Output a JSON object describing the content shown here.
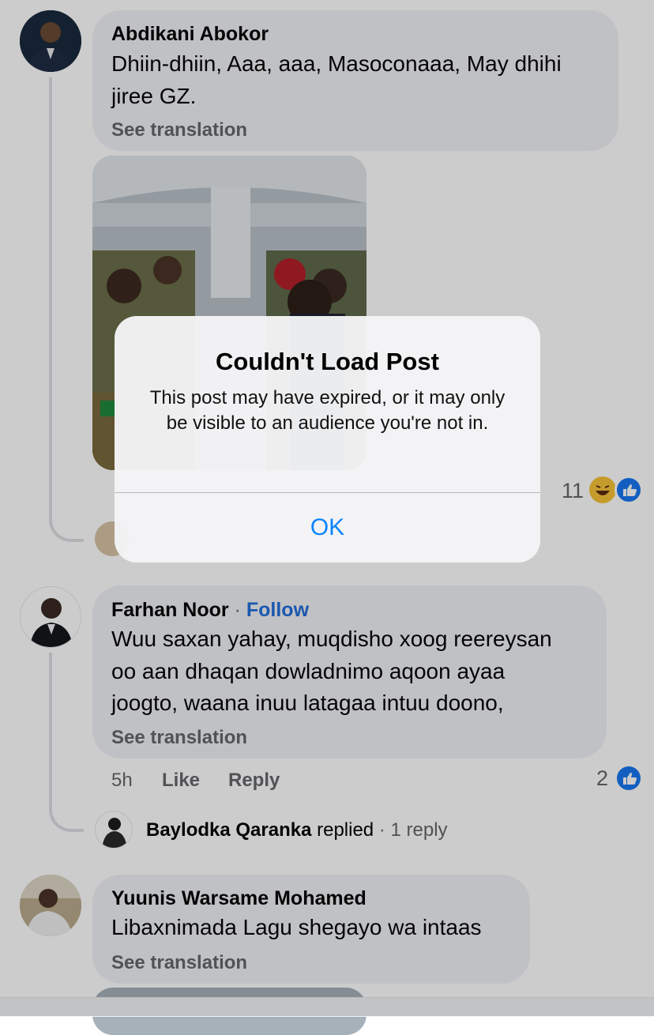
{
  "comments": [
    {
      "author": "Abdikani Abokor",
      "text_line1": "Dhiin-dhiin, Aaa, aaa, Masoconaaa, May dhihi",
      "text_line2": "jiree GZ.",
      "see_translation": "See translation",
      "reaction_count": "11"
    },
    {
      "author": "Farhan Noor",
      "follow_separator": "·",
      "follow_label": "Follow",
      "text_line1": "Wuu saxan yahay, muqdisho xoog reereysan",
      "text_line2": "oo aan dhaqan dowladnimo aqoon ayaa",
      "text_line3": "joogto, waana inuu latagaa intuu doono,",
      "see_translation": "See translation",
      "time": "5h",
      "like_label": "Like",
      "reply_label": "Reply",
      "reaction_count": "2",
      "reply_summary": {
        "replier": "Baylodka Qaranka",
        "replied_word": "replied",
        "separator": "·",
        "count_text": "1 reply"
      }
    },
    {
      "author": "Yuunis Warsame Mohamed",
      "text_line1": "Libaxnimada Lagu shegayo wa intaas",
      "see_translation": "See translation"
    }
  ],
  "dialog": {
    "title": "Couldn't Load Post",
    "message": "This post may have expired, or it may only be visible to an audience you're not in.",
    "ok_label": "OK"
  },
  "colors": {
    "accent": "#0a84ff",
    "follow": "#216fdb",
    "like_blue": "#1877f2",
    "bubble": "#f0f2f5",
    "meta_gray": "#65676b"
  }
}
